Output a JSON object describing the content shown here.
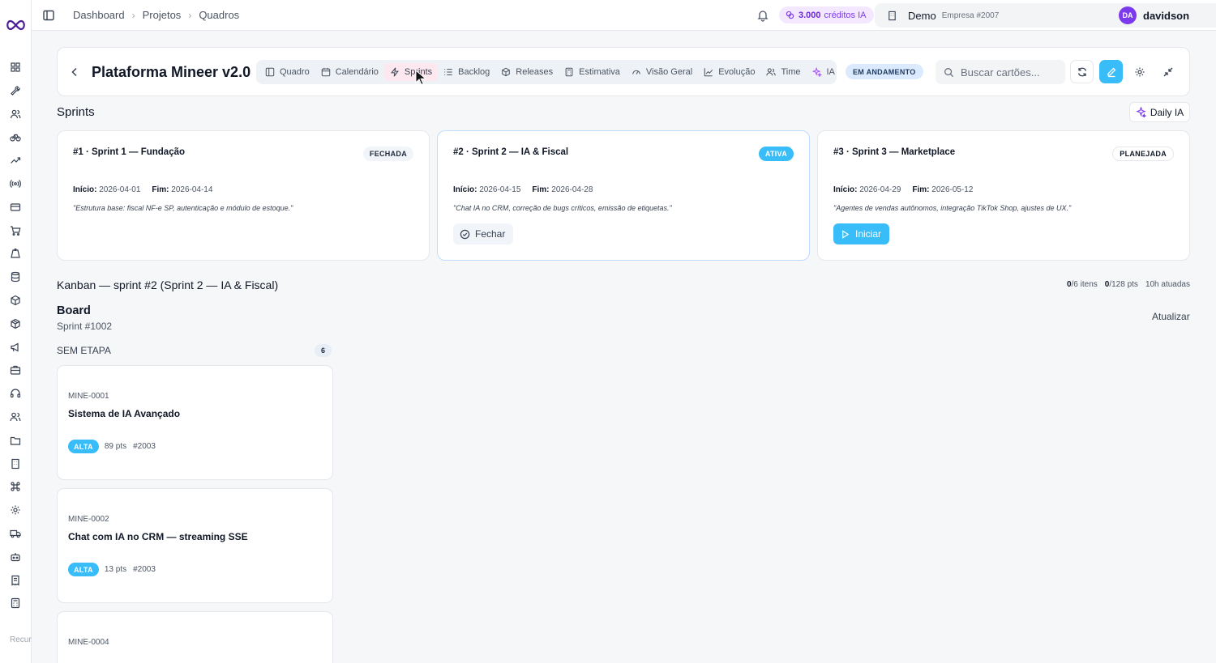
{
  "sidebar": {
    "icons": [
      "grid-icon",
      "tools-icon",
      "users-icon",
      "bike-icon",
      "trending-icon",
      "radio-icon",
      "card-icon",
      "cart-icon",
      "weight-icon",
      "database-icon",
      "box-icon",
      "package-icon",
      "megaphone-icon",
      "briefcase-icon",
      "headset-icon",
      "team-icon",
      "folder-icon",
      "building-icon",
      "command-icon",
      "gear-icon",
      "truck-icon",
      "robot-icon",
      "receipt-icon",
      "calculator-icon"
    ],
    "footer": "Recursos avançados"
  },
  "topbar": {
    "breadcrumbs": [
      "Dashboard",
      "Projetos",
      "Quadros"
    ],
    "credits_amount": "3.000",
    "credits_label": "créditos IA",
    "company_name": "Demo",
    "company_sub": "Empresa #2007",
    "user_initials": "DA",
    "user_name": "davidson"
  },
  "project": {
    "title": "Plataforma Mineer v2.0",
    "tabs": [
      {
        "label": "Quadro",
        "icon": "board-icon"
      },
      {
        "label": "Calendário",
        "icon": "calendar-icon"
      },
      {
        "label": "Sprints",
        "icon": "bolt-icon",
        "active": true
      },
      {
        "label": "Backlog",
        "icon": "list-icon"
      },
      {
        "label": "Releases",
        "icon": "package-icon"
      },
      {
        "label": "Estimativa",
        "icon": "calc-icon"
      },
      {
        "label": "Visão Geral",
        "icon": "gauge-icon"
      },
      {
        "label": "Evolução",
        "icon": "chart-icon"
      },
      {
        "label": "Time",
        "icon": "team-icon"
      },
      {
        "label": "IA",
        "icon": "sparkle-icon"
      }
    ],
    "status": "EM ANDAMENTO",
    "search_placeholder": "Buscar cartões..."
  },
  "sprints_section": {
    "title": "Sprints",
    "daily_label": "Daily IA",
    "start_label": "Início:",
    "end_label": "Fim:",
    "cards": [
      {
        "title": "#1 · Sprint 1 — Fundação",
        "badge": "FECHADA",
        "start": "2026-04-01",
        "end": "2026-04-14",
        "desc": "\"Estrutura base: fiscal NF-e SP, autenticação e módulo de estoque.\""
      },
      {
        "title": "#2 · Sprint 2 — IA & Fiscal",
        "badge": "ATIVA",
        "start": "2026-04-15",
        "end": "2026-04-28",
        "desc": "\"Chat IA no CRM, correção de bugs críticos, emissão de etiquetas.\"",
        "action": "Fechar"
      },
      {
        "title": "#3 · Sprint 3 — Marketplace",
        "badge": "PLANEJADA",
        "start": "2026-04-29",
        "end": "2026-05-12",
        "desc": "\"Agentes de vendas autônomos, integração TikTok Shop, ajustes de UX.\"",
        "action": "Iniciar"
      }
    ]
  },
  "kanban": {
    "title": "Kanban — sprint #2 (Sprint 2 — IA & Fiscal)",
    "items_done": "0",
    "items_rest": "/6 itens",
    "pts_done": "0",
    "pts_rest": "/128 pts",
    "hours": "10h atuadas",
    "board_title": "Board",
    "board_sub": "Sprint #1002",
    "refresh_label": "Atualizar",
    "column_title": "SEM ETAPA",
    "column_count": "6",
    "cards": [
      {
        "code": "MINE-0001",
        "title": "Sistema de IA Avançado",
        "priority": "ALTA",
        "pts": "89 pts",
        "tag": "#2003"
      },
      {
        "code": "MINE-0002",
        "title": "Chat com IA no CRM — streaming SSE",
        "priority": "ALTA",
        "pts": "13 pts",
        "tag": "#2003"
      },
      {
        "code": "MINE-0004"
      }
    ]
  },
  "colors": {
    "accent": "#38bdf8",
    "purple": "#7c3aed",
    "active_tab": "#fde8ef"
  }
}
